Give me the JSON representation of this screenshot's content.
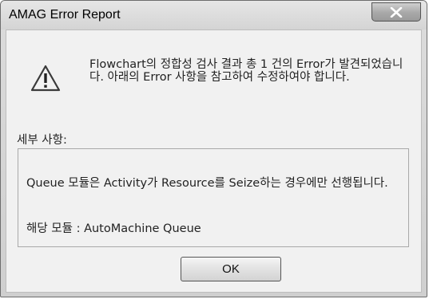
{
  "window": {
    "title": "AMAG Error Report"
  },
  "icons": {
    "close": "close-icon",
    "warning": "warning-icon"
  },
  "message": {
    "text": "Flowchart의 정합성 검사 결과 총 1 건의 Error가 발견되었습니다. 아래의 Error 사항을 참고하여 수정하여야 합니다."
  },
  "details": {
    "label": "세부 사항:",
    "line1": "Queue 모듈은 Activity가 Resource를 Seize하는 경우에만 선행됩니다.",
    "line2": "해당 모듈 : AutoMachine Queue"
  },
  "buttons": {
    "ok": "OK"
  }
}
